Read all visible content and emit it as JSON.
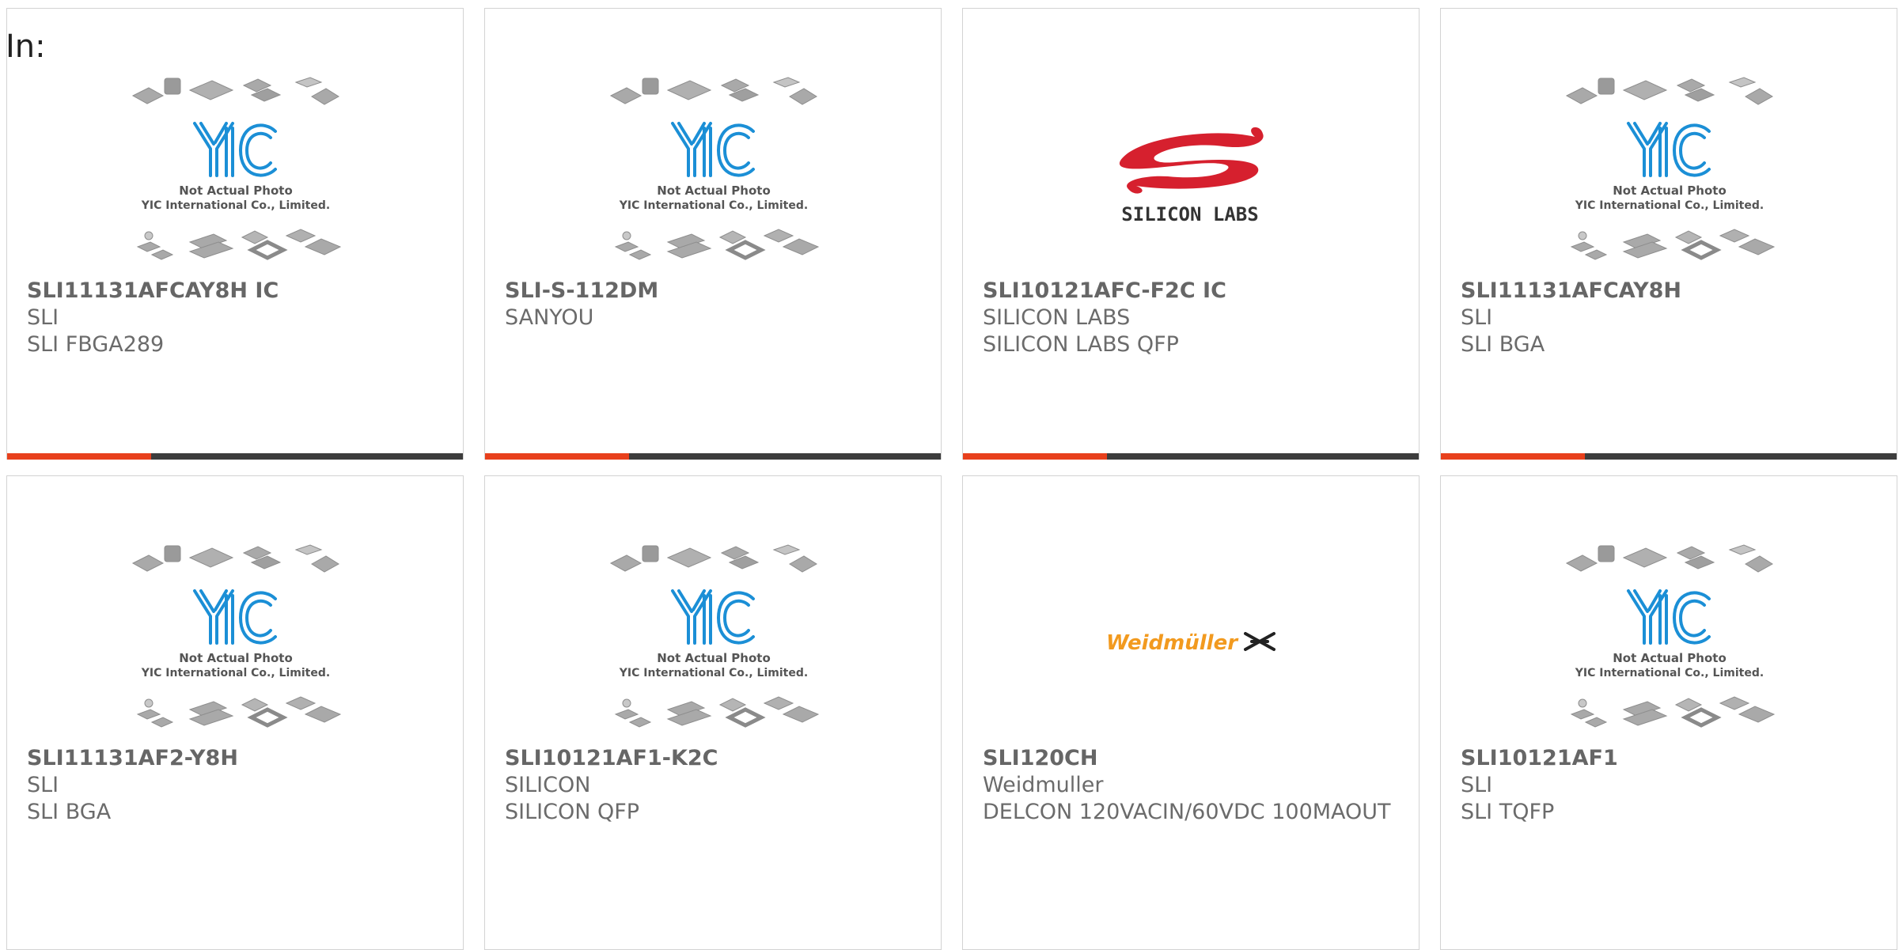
{
  "page": {
    "label": "In:"
  },
  "colors": {
    "accent": "#e8401c",
    "bar": "#3d3d3d",
    "yic_blue": "#1b8fd6"
  },
  "cards": [
    {
      "thumb": "yic-placeholder",
      "caption1": "Not Actual Photo",
      "caption2": "YIC International Co., Limited.",
      "part": "SLI11131AFCAY8H IC",
      "manufacturer": "SLI",
      "description": "SLI FBGA289"
    },
    {
      "thumb": "yic-placeholder",
      "caption1": "Not Actual Photo",
      "caption2": "YIC International Co., Limited.",
      "part": "SLI-S-112DM",
      "manufacturer": "SANYOU",
      "description": ""
    },
    {
      "thumb": "silicon-labs-logo",
      "logo_text": "SILICON LABS",
      "part": "SLI10121AFC-F2C IC",
      "manufacturer": "SILICON LABS",
      "description": "SILICON LABS QFP"
    },
    {
      "thumb": "yic-placeholder",
      "caption1": "Not Actual Photo",
      "caption2": "YIC International Co., Limited.",
      "part": "SLI11131AFCAY8H",
      "manufacturer": "SLI",
      "description": "SLI BGA"
    },
    {
      "thumb": "yic-placeholder",
      "caption1": "Not Actual Photo",
      "caption2": "YIC International Co., Limited.",
      "part": "SLI11131AF2-Y8H",
      "manufacturer": "SLI",
      "description": "SLI BGA"
    },
    {
      "thumb": "yic-placeholder",
      "caption1": "Not Actual Photo",
      "caption2": "YIC International Co., Limited.",
      "part": "SLI10121AF1-K2C",
      "manufacturer": "SILICON",
      "description": "SILICON QFP"
    },
    {
      "thumb": "weidmuller-logo",
      "logo_text": "Weidmüller",
      "part": "SLI120CH",
      "manufacturer": "Weidmuller",
      "description": "DELCON 120VACIN/60VDC 100MAOUT"
    },
    {
      "thumb": "yic-placeholder",
      "caption1": "Not Actual Photo",
      "caption2": "YIC International Co., Limited.",
      "part": "SLI10121AF1",
      "manufacturer": "SLI",
      "description": "SLI TQFP"
    }
  ]
}
